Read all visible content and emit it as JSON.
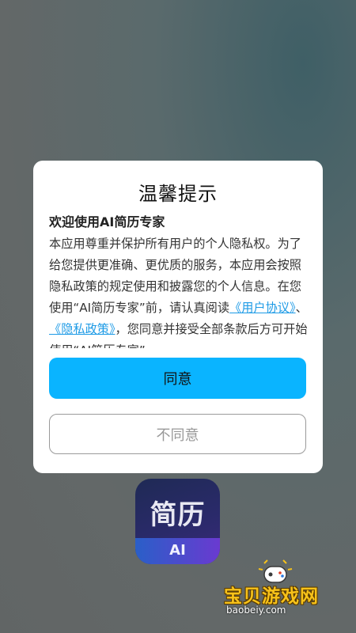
{
  "dialog": {
    "title": "温馨提示",
    "welcome": "欢迎使用AI简历专家",
    "body": {
      "part1": "本应用尊重并保护所有用户的个人隐私权。为了给您提供更准确、更优质的服务，本应用会按照隐私政策的规定使用和披露您的个人信息。在您使用“AI简历专家”前，请认真阅读",
      "link_user_agreement": "《用户协议》",
      "separator": "、",
      "link_privacy_policy": "《隐私政策》",
      "part2": "，您同意并接受全部条款后方可开始使用“AI简历专家”"
    },
    "agree_label": "同意",
    "disagree_label": "不同意"
  },
  "app_icon": {
    "text": "简历",
    "badge": "AI"
  },
  "watermark": {
    "title": "宝贝游戏网",
    "url": "baobeiy.com"
  },
  "colors": {
    "accent": "#0ab4ff",
    "link": "#1e9be6"
  }
}
